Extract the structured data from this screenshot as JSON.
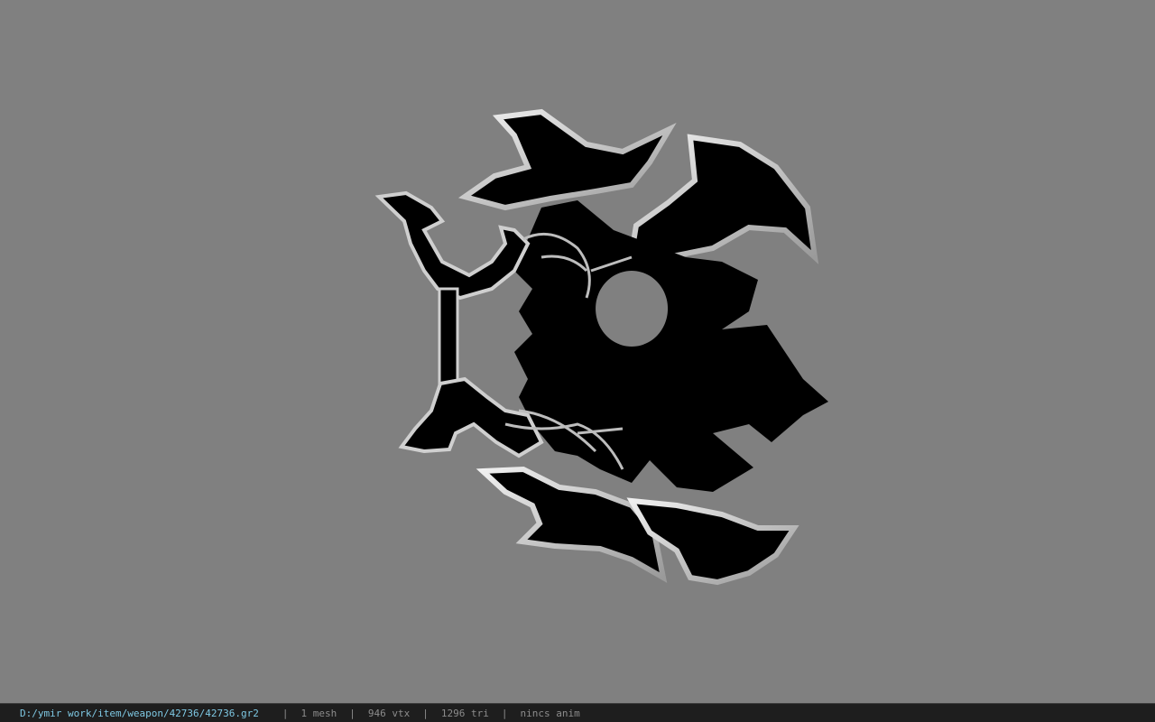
{
  "viewer": {
    "background_color": "#808080",
    "model": {
      "description_icon": "axe-weapon-model",
      "fill_color": "#000000",
      "edge_color": "#d8d8d8"
    }
  },
  "status_bar": {
    "file_path": "D:/ymir work/item/weapon/42736/42736.gr2",
    "mesh_count": "1 mesh",
    "vertex_count": "946 vtx",
    "triangle_count": "1296 tri",
    "animation": "nincs anim",
    "separator": "|",
    "path_color": "#7ec8e3",
    "text_color": "#8c8c8c"
  }
}
